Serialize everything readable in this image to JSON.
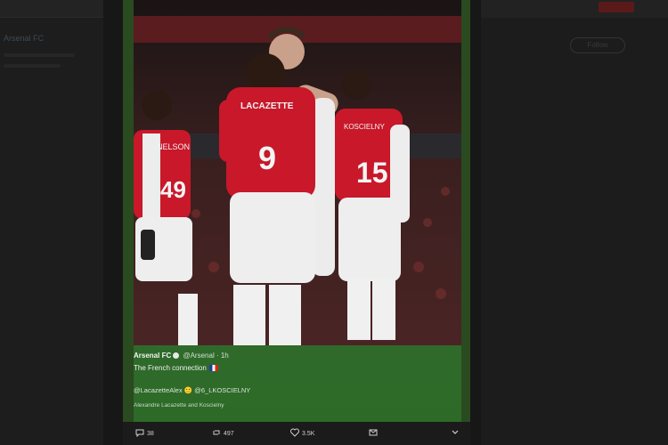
{
  "background": {
    "left_label": "Arsenal FC"
  },
  "right_panel": {
    "follow_label": "Follow"
  },
  "tweet": {
    "author_name": "Arsenal FC",
    "author_handle": "@Arsenal",
    "time": "· 1h",
    "text": "The French connection",
    "mentions": "@LacazetteAlex 🙂 @6_LKOSCIELNY",
    "photo_credit": "Alexandre Lacazette and Koscielny",
    "photo": {
      "jersey_numbers": [
        "9",
        "15",
        "49"
      ],
      "jersey_names": [
        "LACAZETTE",
        "KOSCIELNY",
        "NELSON"
      ]
    },
    "actions": {
      "reply_count": "38",
      "retweet_count": "497",
      "like_count": "3.5K"
    }
  },
  "colors": {
    "accent_red": "#c8102e",
    "pitch_green": "#2d6a27"
  }
}
